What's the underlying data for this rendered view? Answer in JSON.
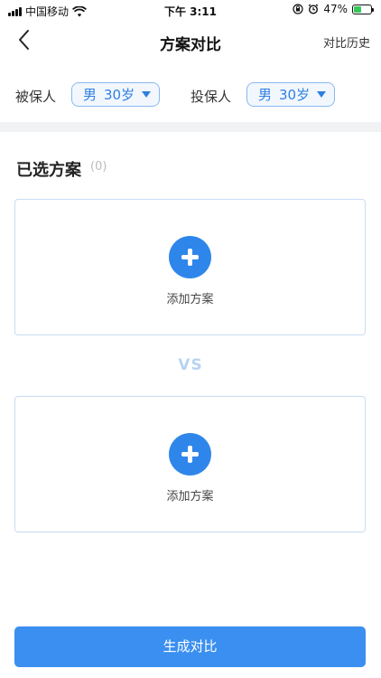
{
  "status_bar": {
    "carrier": "中国移动",
    "time": "下午 3:11",
    "battery_percent": "47%",
    "battery_level": 0.47,
    "battery_color": "#35c759"
  },
  "nav": {
    "title": "方案对比",
    "history_label": "对比历史",
    "back_icon": "chevron-left-icon"
  },
  "insured": {
    "label": "被保人",
    "gender": "男",
    "age": "30岁"
  },
  "policyholder": {
    "label": "投保人",
    "gender": "男",
    "age": "30岁"
  },
  "selected": {
    "title": "已选方案",
    "count": "(0)"
  },
  "plans": [
    {
      "add_label": "添加方案"
    },
    {
      "add_label": "添加方案"
    }
  ],
  "vs_label": "VS",
  "generate_button": "生成对比",
  "colors": {
    "accent": "#2f86ea",
    "button": "#3a8ff0",
    "vs": "#b8d3f3"
  }
}
